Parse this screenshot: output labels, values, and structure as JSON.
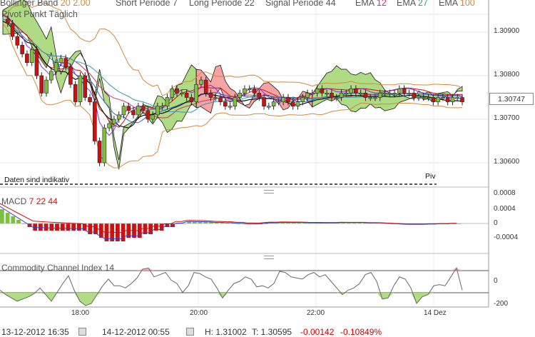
{
  "legend": {
    "bollinger": {
      "label": "Bollinger Band",
      "p1": "20",
      "p2": "2.00"
    },
    "short": {
      "label": "Short Periode",
      "value": "7"
    },
    "long": {
      "label": "Long Periode",
      "value": "22"
    },
    "signal": {
      "label": "Signal Periode",
      "value": "44"
    },
    "ema1": {
      "label": "EMA",
      "value": "12"
    },
    "ema2": {
      "label": "EMA",
      "value": "27"
    },
    "ema3": {
      "label": "EMA",
      "value": "100"
    },
    "pivot": "Pivot Punkt Täglich"
  },
  "main_panel": {
    "note": "Daten sind indikativ",
    "piv_label": "Piv",
    "price_ticks": [
      "1.30900",
      "1.30800",
      "1.30700",
      "1.30600"
    ],
    "last_price": "1.30747"
  },
  "macd_panel": {
    "label": "MACD",
    "p1": "7",
    "p2": "22",
    "p3": "44",
    "ticks": [
      "0.0008",
      "0.0004",
      "0",
      "-0.0004"
    ]
  },
  "cci_panel": {
    "label": "Commodity Channel Index",
    "period": "14",
    "ticks": [
      "0",
      "-200"
    ]
  },
  "time_axis": [
    "18:00",
    "20:00",
    "22:00",
    "14 Dez"
  ],
  "status_bar": {
    "from": "13-12-2012 16:35",
    "to": "14-12-2012 00:55",
    "high": "H: 1.31002",
    "low": "T: 1.30595",
    "change": "-0.00142",
    "change_pct": "-0.10849%"
  },
  "colors": {
    "bull": "#7fbf3f",
    "bear": "#cc1111",
    "cloud_green": "#a8d878",
    "cloud_red": "#f59a9a",
    "boll": "#d08a3a",
    "ema12": "#cc3366",
    "ema27": "#3399aa",
    "ema100": "#cc8844"
  },
  "chart_data": [
    {
      "type": "candlestick",
      "title": "",
      "ylim": [
        1.3055,
        1.3098
      ],
      "x": [
        "18:00",
        "20:00",
        "22:00",
        "14 Dez"
      ],
      "close_series": [
        1.3093,
        1.3092,
        1.3089,
        1.3087,
        1.3085,
        1.3083,
        1.3086,
        1.308,
        1.3076,
        1.3079,
        1.3081,
        1.3083,
        1.3084,
        1.3082,
        1.3078,
        1.3074,
        1.308,
        1.3075,
        1.3074,
        1.3065,
        1.306,
        1.3068,
        1.3069,
        1.307,
        1.3071,
        1.3073,
        1.3072,
        1.3071,
        1.3073,
        1.3072,
        1.307,
        1.3071,
        1.3073,
        1.3073,
        1.3075,
        1.3077,
        1.3076,
        1.3076,
        1.3075,
        1.3074,
        1.3078,
        1.3079,
        1.3076,
        1.3075,
        1.3075,
        1.3074,
        1.3073,
        1.3073,
        1.3075,
        1.3076,
        1.3077,
        1.3077,
        1.3076,
        1.3075,
        1.3073,
        1.3073,
        1.3074,
        1.3074,
        1.3075,
        1.3074,
        1.3073,
        1.3074,
        1.3075,
        1.3076,
        1.3076,
        1.3077,
        1.3076,
        1.3076,
        1.3075,
        1.3075,
        1.3076,
        1.3076,
        1.3077,
        1.3076,
        1.3076,
        1.3075,
        1.3075,
        1.3075,
        1.3076,
        1.3076,
        1.3076,
        1.3076,
        1.3077,
        1.3076,
        1.3076,
        1.3075,
        1.3075,
        1.3075,
        1.3075,
        1.3074,
        1.3075,
        1.3075,
        1.3074,
        1.3075,
        1.3075,
        1.3074
      ],
      "last": 1.30747
    },
    {
      "type": "bar",
      "title": "MACD 7 22 44",
      "ylim": [
        -0.0006,
        0.0008
      ],
      "values": [
        0.0004,
        0.0003,
        0.0002,
        0.0001,
        0.0,
        -0.0001,
        -0.0002,
        -0.0002,
        -0.0002,
        -0.0002,
        -0.0002,
        -0.0002,
        -0.0002,
        -0.0002,
        -0.0002,
        -0.0002,
        -0.0003,
        -0.0003,
        -0.0004,
        -0.0005,
        -0.0005,
        -0.0005,
        -0.0005,
        -0.0004,
        -0.0004,
        -0.0004,
        -0.0003,
        -0.0003,
        -0.0002,
        -0.0002,
        -0.0001,
        -0.0001,
        0.0,
        0.0,
        5e-05,
        5e-05,
        5e-05,
        5e-05,
        4e-05,
        3e-05,
        3e-05,
        2e-05,
        2e-05,
        0.0,
        0.0,
        -2e-05,
        -2e-05,
        -2e-05,
        0.0,
        2e-05,
        2e-05,
        3e-05,
        3e-05,
        3e-05,
        3e-05,
        3e-05,
        2e-05,
        2e-05,
        2e-05,
        2e-05,
        2e-05,
        2e-05,
        3e-05,
        3e-05,
        3e-05,
        3e-05,
        3e-05,
        2e-05,
        2e-05,
        2e-05,
        1e-05,
        0.0,
        -1e-05,
        -2e-05,
        -3e-05,
        -3e-05,
        -3e-05,
        -3e-05,
        -2e-05,
        -2e-05,
        -1e-05,
        -1e-05,
        0.0,
        0.0
      ]
    },
    {
      "type": "line",
      "title": "Commodity Channel Index 14",
      "ylim": [
        -260,
        200
      ],
      "values": [
        -80,
        -120,
        -150,
        -180,
        -160,
        -140,
        -110,
        -60,
        -120,
        -180,
        -100,
        -20,
        50,
        -80,
        -180,
        -220,
        -200,
        -120,
        -40,
        20,
        -40,
        -40,
        -60,
        -20,
        30,
        110,
        120,
        40,
        60,
        80,
        10,
        -20,
        -100,
        -40,
        80,
        70,
        40,
        20,
        -60,
        -150,
        -80,
        -20,
        0,
        40,
        20,
        -50,
        -40,
        -60,
        -20,
        90,
        80,
        40,
        30,
        20,
        60,
        80,
        40,
        60,
        0,
        -60,
        -120,
        -80,
        -60,
        -20,
        60,
        80,
        0,
        -160,
        -150,
        -40,
        40,
        20,
        -60,
        -200,
        -140,
        -120,
        -40,
        -30,
        -40,
        40,
        120,
        -80
      ]
    }
  ]
}
